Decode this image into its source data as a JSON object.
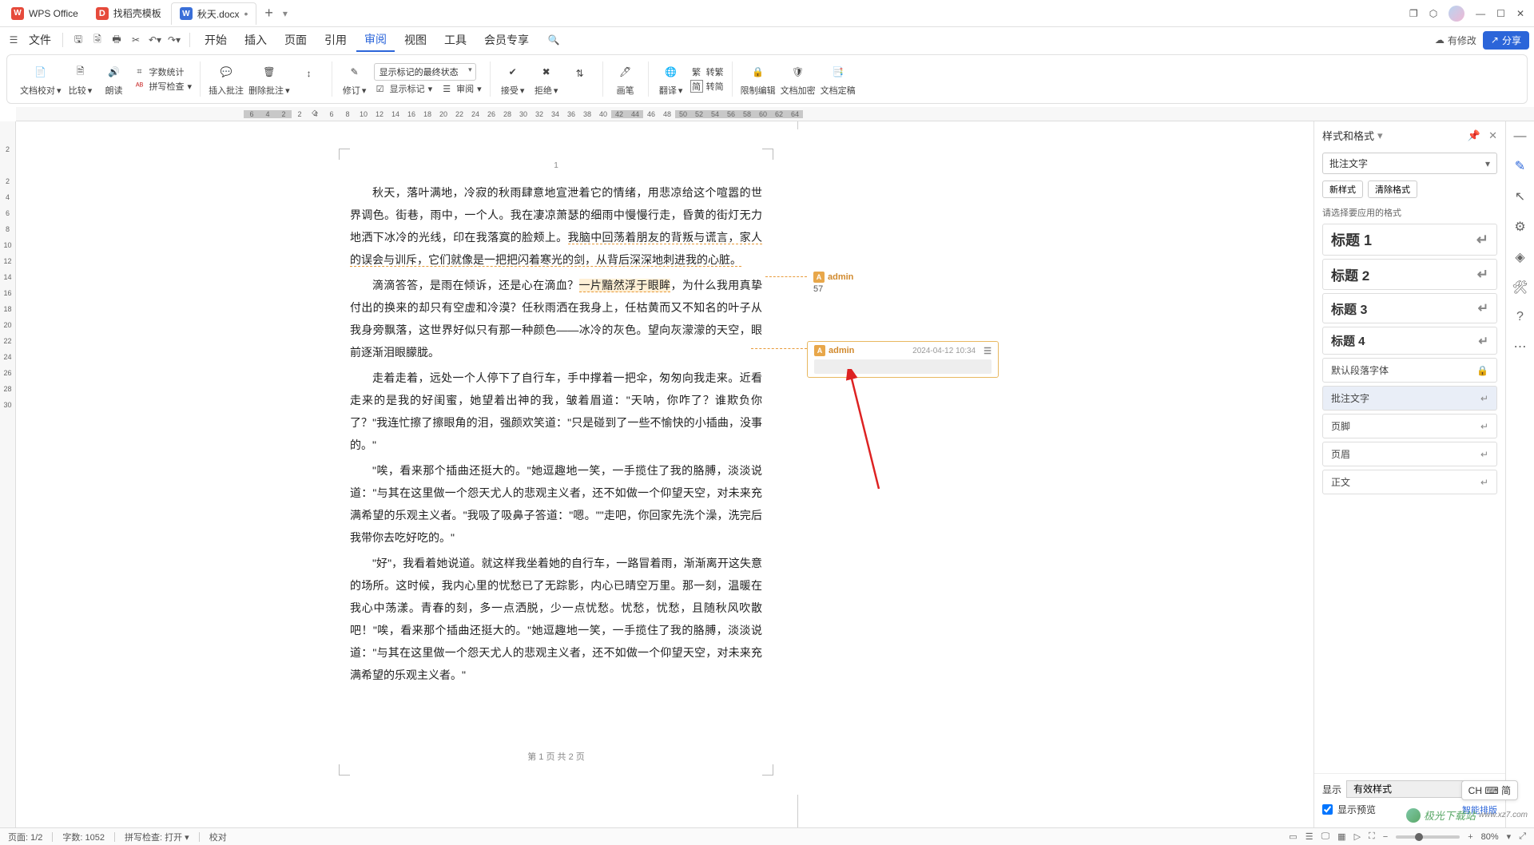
{
  "titlebar": {
    "tabs": [
      {
        "icon": "W",
        "label": "WPS Office"
      },
      {
        "icon": "D",
        "label": "找稻壳模板"
      },
      {
        "icon": "W",
        "label": "秋天.docx"
      }
    ],
    "add": "+"
  },
  "menubar": {
    "file": "文件",
    "items": [
      "开始",
      "插入",
      "页面",
      "引用",
      "审阅",
      "视图",
      "工具",
      "会员专享"
    ],
    "active": "审阅",
    "pending": "有修改",
    "share": "分享"
  },
  "ribbon": {
    "proofread": "文档校对",
    "compare": "比较",
    "read": "朗读",
    "wordcount": "字数统计",
    "spellcheck": "拼写检查",
    "insertcomment": "插入批注",
    "deletecomment": "删除批注",
    "commentnav": "↕",
    "revise": "修订",
    "markupSelect": "显示标记的最终状态",
    "showmarkup": "显示标记",
    "reviewpane": "审阅",
    "accept": "接受",
    "reject": "拒绝",
    "nextchange": "⇄",
    "draw": "画笔",
    "translate": "翻译",
    "simp2trad": "转繁",
    "trad2simp": "转简",
    "simplabel": "简",
    "restrictedit": "限制编辑",
    "docencrypt": "文档加密",
    "docfinal": "文档定稿"
  },
  "ruler": {
    "h_dark": [
      "6",
      "4",
      "2"
    ],
    "h": [
      "2",
      "4",
      "6",
      "8",
      "10",
      "12",
      "14",
      "16",
      "18",
      "20",
      "22",
      "24",
      "26",
      "28",
      "30",
      "32",
      "34",
      "36",
      "38",
      "40"
    ],
    "h_dark2": [
      "42",
      "44"
    ],
    "h2": [
      "46",
      "48"
    ],
    "h_dark3": [
      "50",
      "52",
      "54",
      "56",
      "58",
      "60",
      "62",
      "64"
    ],
    "v": [
      "2",
      "",
      "2",
      "4",
      "6",
      "8",
      "10",
      "12",
      "14",
      "16",
      "18",
      "20",
      "22",
      "24",
      "26",
      "28",
      "30"
    ]
  },
  "doc": {
    "pagenum": "1",
    "p1": "秋天，落叶满地，冷寂的秋雨肆意地宣泄着它的情绪，用悲凉给这个喧嚣的世界调色。街巷，雨中，一个人。我在凄凉萧瑟的细雨中慢慢行走，昏黄的街灯无力地洒下冰冷的光线，印在我落寞的脸颊上。",
    "p1_hl": "我脑中回荡着朋友的背叛与谎言，家人的误会与训斥，它们就像是一把把闪着寒光的剑，从背后深深地刺进我的心脏。",
    "p2a": "滴滴答答，是雨在倾诉，还是心在滴血？",
    "p2_hl": "一片黯然浮于眼眸",
    "p2b": "，为什么我用真挚付出的换来的却只有空虚和冷漠？任秋雨洒在我身上，任枯黄而又不知名的叶子从我身旁飘落，这世界好似只有那一种颜色——冰冷的灰色。望向灰濛濛的天空，眼前逐渐泪眼朦胧。",
    "p3": "走着走着，远处一个人停下了自行车，手中撑着一把伞，匆匆向我走来。近看走来的是我的好闺蜜，她望着出神的我，皱着眉道：\"天呐，你咋了？谁欺负你了？\"我连忙擦了擦眼角的泪，强颜欢笑道：\"只是碰到了一些不愉快的小插曲，没事的。\"",
    "p4": "\"唉，看来那个插曲还挺大的。\"她逗趣地一笑，一手揽住了我的胳膊，淡淡说道：\"与其在这里做一个怨天尤人的悲观主义者，还不如做一个仰望天空，对未来充满希望的乐观主义者。\"我吸了吸鼻子答道：\"嗯。\"\"走吧，你回家先洗个澡，洗完后我带你去吃好吃的。\"",
    "p5": "\"好\"，我看着她说道。就这样我坐着她的自行车，一路冒着雨，渐渐离开这失意的场所。这时候，我内心里的忧愁已了无踪影，内心已晴空万里。那一刻，温暖在我心中荡漾。青春的刻，多一点洒脱，少一点忧愁。忧愁，忧愁，且随秋风吹散吧！\"唉，看来那个插曲还挺大的。\"她逗趣地一笑，一手揽住了我的胳膊，淡淡说道：\"与其在这里做一个怨天尤人的悲观主义者，还不如做一个仰望天空，对未来充满希望的乐观主义者。\"",
    "footer": "第 1 页 共 2 页"
  },
  "comments": {
    "c1_user": "admin",
    "c1_body": "57",
    "c2_user": "admin",
    "c2_time": "2024-04-12 10:34"
  },
  "rightpanel": {
    "title": "样式和格式",
    "select": "批注文字",
    "newstyle": "新样式",
    "clearformat": "清除格式",
    "hint": "请选择要应用的格式",
    "styles": [
      {
        "label": "标题 1",
        "cls": "h1"
      },
      {
        "label": "标题 2",
        "cls": "h2"
      },
      {
        "label": "标题 3",
        "cls": "h3"
      },
      {
        "label": "标题 4",
        "cls": "h4"
      },
      {
        "label": "默认段落字体",
        "cls": "small lock"
      },
      {
        "label": "批注文字",
        "cls": "small sel"
      },
      {
        "label": "页脚",
        "cls": "small"
      },
      {
        "label": "页眉",
        "cls": "small"
      },
      {
        "label": "正文",
        "cls": "small"
      }
    ],
    "showlabel": "显示",
    "showopt": "有效样式",
    "preview": "显示预览",
    "smart": "智能排版"
  },
  "ime": "CH ⌨ 简",
  "watermark": {
    "name": "极光下载站",
    "url": "www.xz7.com"
  },
  "statusbar": {
    "page": "页面: 1/2",
    "words": "字数: 1052",
    "spell": "拼写检查: 打开",
    "proof": "校对",
    "zoom": "80%"
  }
}
